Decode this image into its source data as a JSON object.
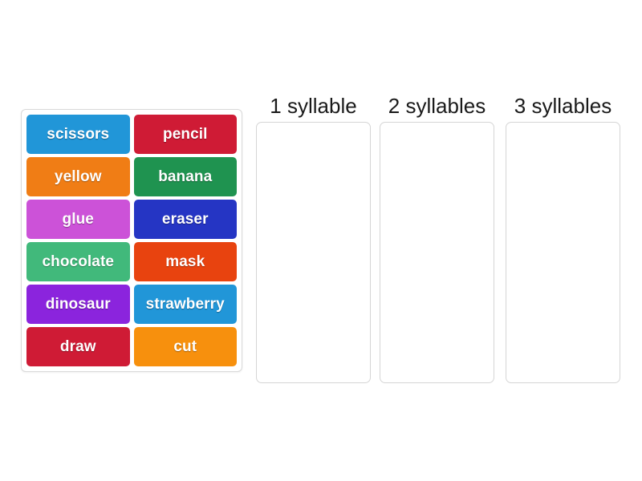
{
  "activity": {
    "type": "drag-and-drop-sort",
    "background_color": "#ffffff"
  },
  "tray": {
    "name": "word-tile-tray",
    "border_color": "#d9d9d9",
    "tiles": [
      {
        "label": "scissors",
        "color": "#2196d8"
      },
      {
        "label": "pencil",
        "color": "#cf1b35"
      },
      {
        "label": "yellow",
        "color": "#f07d15"
      },
      {
        "label": "banana",
        "color": "#1f9350"
      },
      {
        "label": "glue",
        "color": "#cc52d8"
      },
      {
        "label": "eraser",
        "color": "#2535c4"
      },
      {
        "label": "chocolate",
        "color": "#41b97b"
      },
      {
        "label": "mask",
        "color": "#e8430f"
      },
      {
        "label": "dinosaur",
        "color": "#8b24dd"
      },
      {
        "label": "strawberry",
        "color": "#2196d8"
      },
      {
        "label": "draw",
        "color": "#cf1b35"
      },
      {
        "label": "cut",
        "color": "#f7900d"
      }
    ]
  },
  "zones": [
    {
      "label": "1 syllable",
      "items": []
    },
    {
      "label": "2 syllables",
      "items": []
    },
    {
      "label": "3 syllables",
      "items": []
    }
  ]
}
